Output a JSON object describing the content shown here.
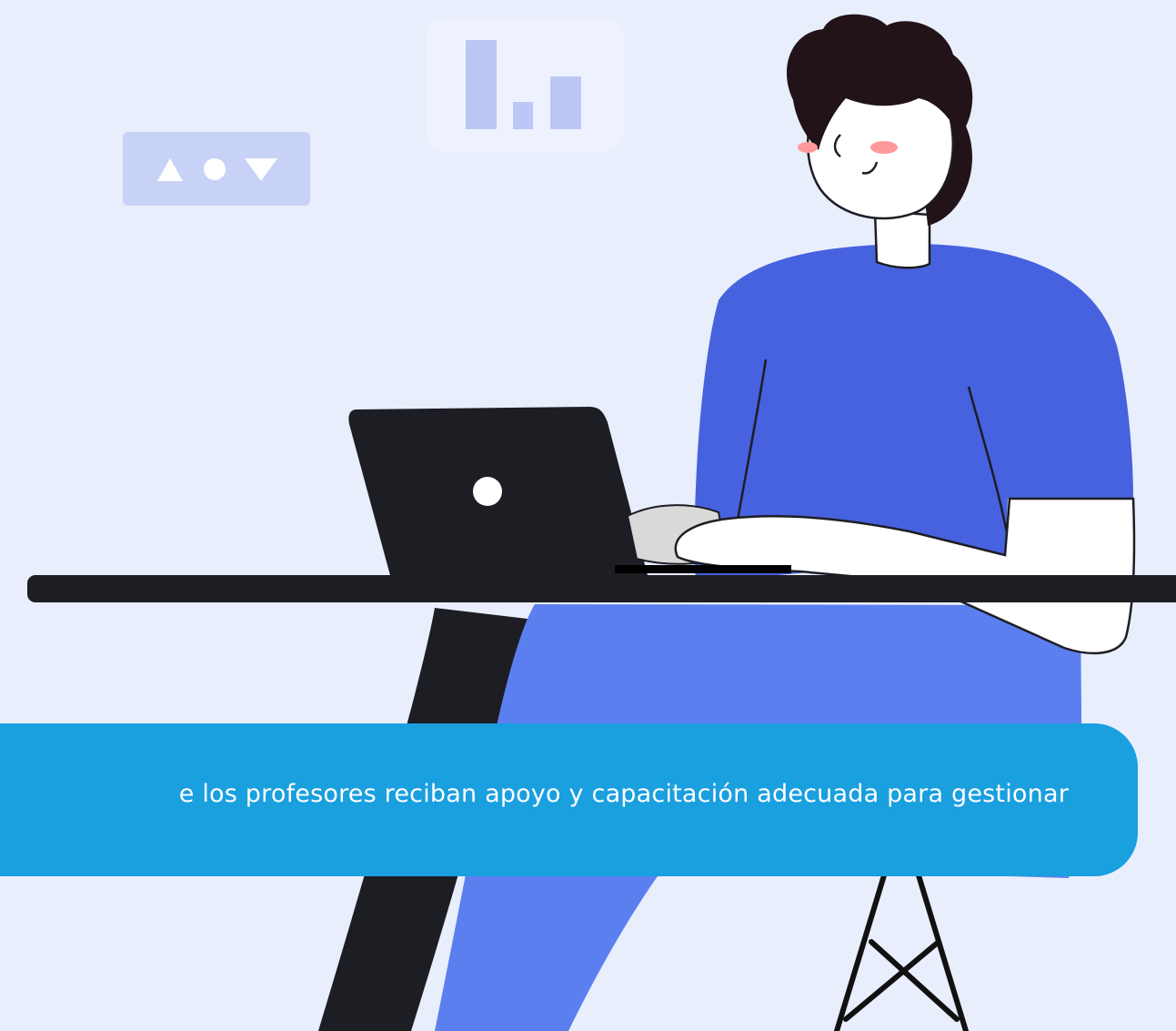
{
  "scene": {
    "background_color": "#e8eefc",
    "shapes_badge_icon": "triangle-circle-triangle-icon",
    "chart_badge_icon": "bar-chart-icon",
    "colors": {
      "shirt": "#4762de",
      "pants": "#5c7ff0",
      "dark": "#1d1d24",
      "skin": "#ffffff",
      "hair": "#221318",
      "blush": "#ff9a9a",
      "badge": "#c8d2f7",
      "badge_light": "#eef2ff",
      "banner": "#1a9fdf"
    }
  },
  "caption": {
    "text": "e los profesores reciban apoyo y capacitación adecuada para gestionar"
  }
}
